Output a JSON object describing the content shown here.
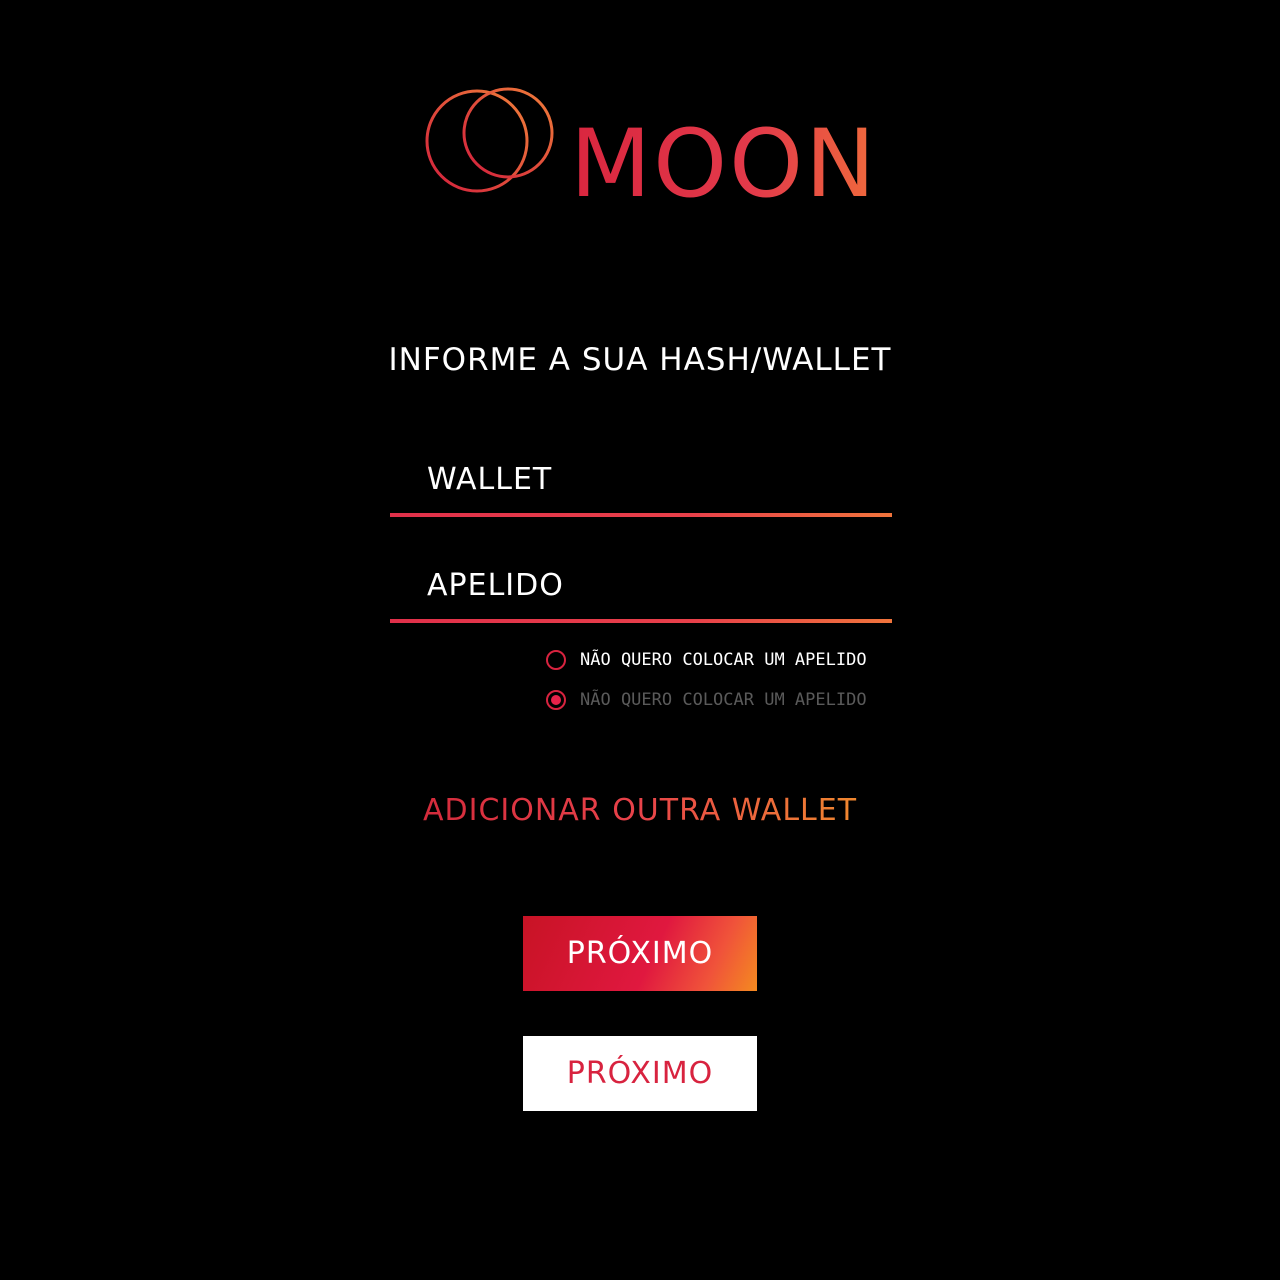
{
  "logo": {
    "text": "MOON",
    "icon": "double-ring-icon",
    "gradient": [
      "#d4223c",
      "#f08a3a"
    ]
  },
  "form": {
    "heading": "INFORME A SUA HASH/WALLET",
    "wallet_placeholder": "WALLET",
    "nickname_placeholder": "APELIDO",
    "options": [
      {
        "label": "NÃO QUERO COLOCAR UM APELIDO",
        "checked": false
      },
      {
        "label": "NÃO QUERO COLOCAR UM APELIDO",
        "checked": true
      }
    ]
  },
  "add_wallet": {
    "label": "ADICIONAR OUTRA WALLET"
  },
  "buttons": {
    "primary_label": "PRÓXIMO",
    "secondary_label": "PRÓXIMO"
  },
  "colors": {
    "background": "#000000",
    "accent_red": "#d8233f",
    "accent_orange": "#f0882f",
    "muted_text": "#5a5a5a"
  }
}
